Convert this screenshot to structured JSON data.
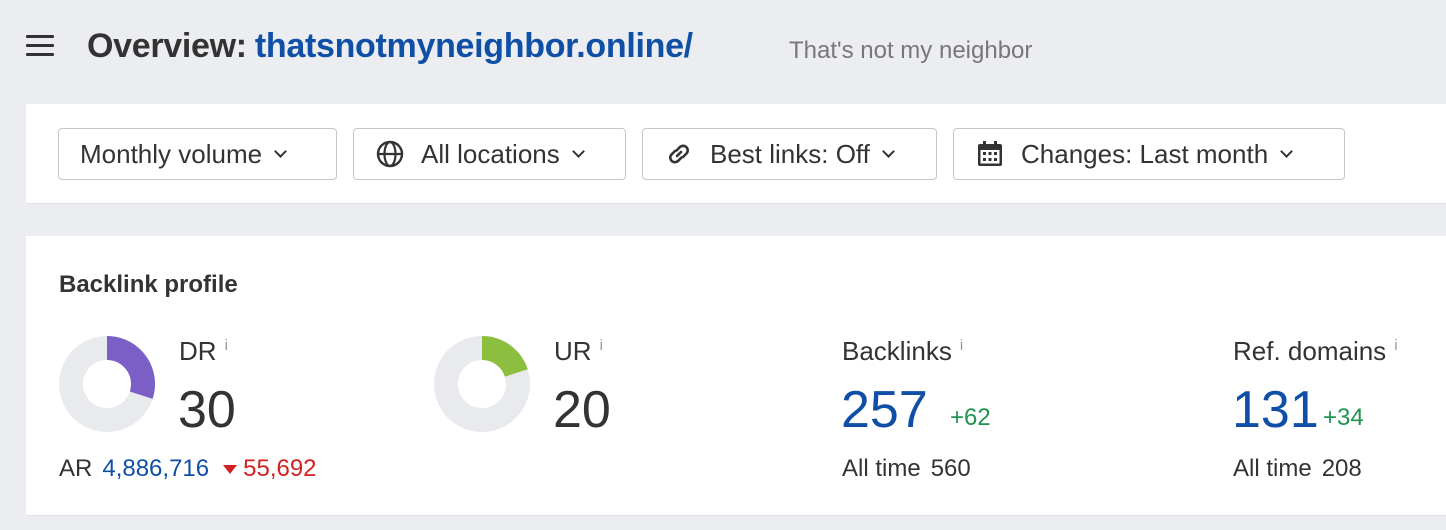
{
  "header": {
    "title_prefix": "Overview:",
    "domain": "thatsnotmyneighbor.online/",
    "subtitle": "That's not my neighbor"
  },
  "filters": {
    "volume": "Monthly volume",
    "locations": "All locations",
    "best_links": "Best links: Off",
    "changes": "Changes: Last month"
  },
  "backlink_profile": {
    "title": "Backlink profile",
    "dr": {
      "label": "DR",
      "value": "30",
      "fill_fraction": 0.3,
      "color": "#7b5fc7"
    },
    "ar": {
      "label": "AR",
      "value": "4,886,716",
      "change": "55,692"
    },
    "ur": {
      "label": "UR",
      "value": "20",
      "fill_fraction": 0.2,
      "color": "#8cbf3f"
    },
    "backlinks": {
      "label": "Backlinks",
      "value": "257",
      "change": "+62",
      "all_time_label": "All time",
      "all_time_value": "560"
    },
    "ref_domains": {
      "label": "Ref. domains",
      "value": "131",
      "change": "+34",
      "all_time_label": "All time",
      "all_time_value": "208"
    },
    "info_glyph": "i"
  },
  "colors": {
    "link_blue": "#0f4fa6",
    "positive_green": "#1f9450",
    "negative_red": "#d32121",
    "donut_track": "#e9eaed"
  },
  "icons": {
    "menu": "hamburger-icon",
    "globe": "globe-icon",
    "link": "link-icon",
    "calendar": "calendar-icon",
    "chevron": "chevron-down-icon"
  }
}
